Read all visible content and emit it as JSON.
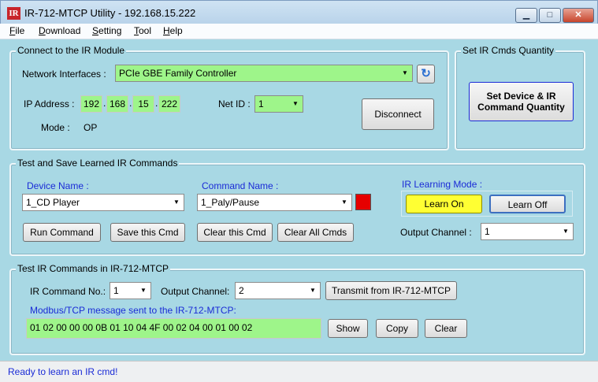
{
  "window": {
    "icon_text": "IR",
    "title": "IR-712-MTCP Utility - 192.168.15.222",
    "min_glyph": "▁",
    "max_glyph": "□",
    "close_glyph": "✕"
  },
  "menu": [
    "File",
    "Download",
    "Setting",
    "Tool",
    "Help"
  ],
  "connect": {
    "group_title": "Connect to the IR Module",
    "net_label": "Network Interfaces :",
    "net_value": "PCIe GBE Family Controller",
    "refresh_icon": "↻",
    "ip_label": "IP Address :",
    "ip": [
      "192",
      "168",
      "15",
      "222"
    ],
    "netid_label": "Net ID :",
    "netid_value": "1",
    "mode_label": "Mode :",
    "mode_value": "OP",
    "disconnect": "Disconnect"
  },
  "quantity": {
    "group_title": "Set IR Cmds Quantity",
    "button_line1": "Set Device & IR",
    "button_line2": "Command Quantity"
  },
  "learn": {
    "group_title": "Test and Save Learned IR Commands",
    "device_label": "Device Name :",
    "device_value": "1_CD Player",
    "command_label": "Command Name :",
    "command_value": "1_Paly/Pause",
    "indicator_color": "#e60000",
    "mode_label": "IR Learning Mode :",
    "learn_on": "Learn On",
    "learn_off": "Learn Off",
    "run": "Run Command",
    "save": "Save this Cmd",
    "clear_cmd": "Clear this Cmd",
    "clear_all": "Clear All Cmds",
    "output_label": "Output Channel :",
    "output_value": "1"
  },
  "test": {
    "group_title": "Test IR Commands in IR-712-MTCP",
    "cmd_no_label": "IR Command No.:",
    "cmd_no_value": "1",
    "output_label": "Output Channel:",
    "output_value": "2",
    "transmit": "Transmit from IR-712-MTCP",
    "msg_label": "Modbus/TCP message sent to the IR-712-MTCP:",
    "msg_value": "01 02 00 00 00 0B 01 10 04 4F 00 02 04 00 01 00 02",
    "show": "Show",
    "copy": "Copy",
    "clear": "Clear"
  },
  "status": "Ready to learn an IR cmd!",
  "colors": {
    "accent_blue": "#1a2bd6",
    "field_green": "#9ef58a",
    "learn_on_yellow": "#ffff33"
  }
}
